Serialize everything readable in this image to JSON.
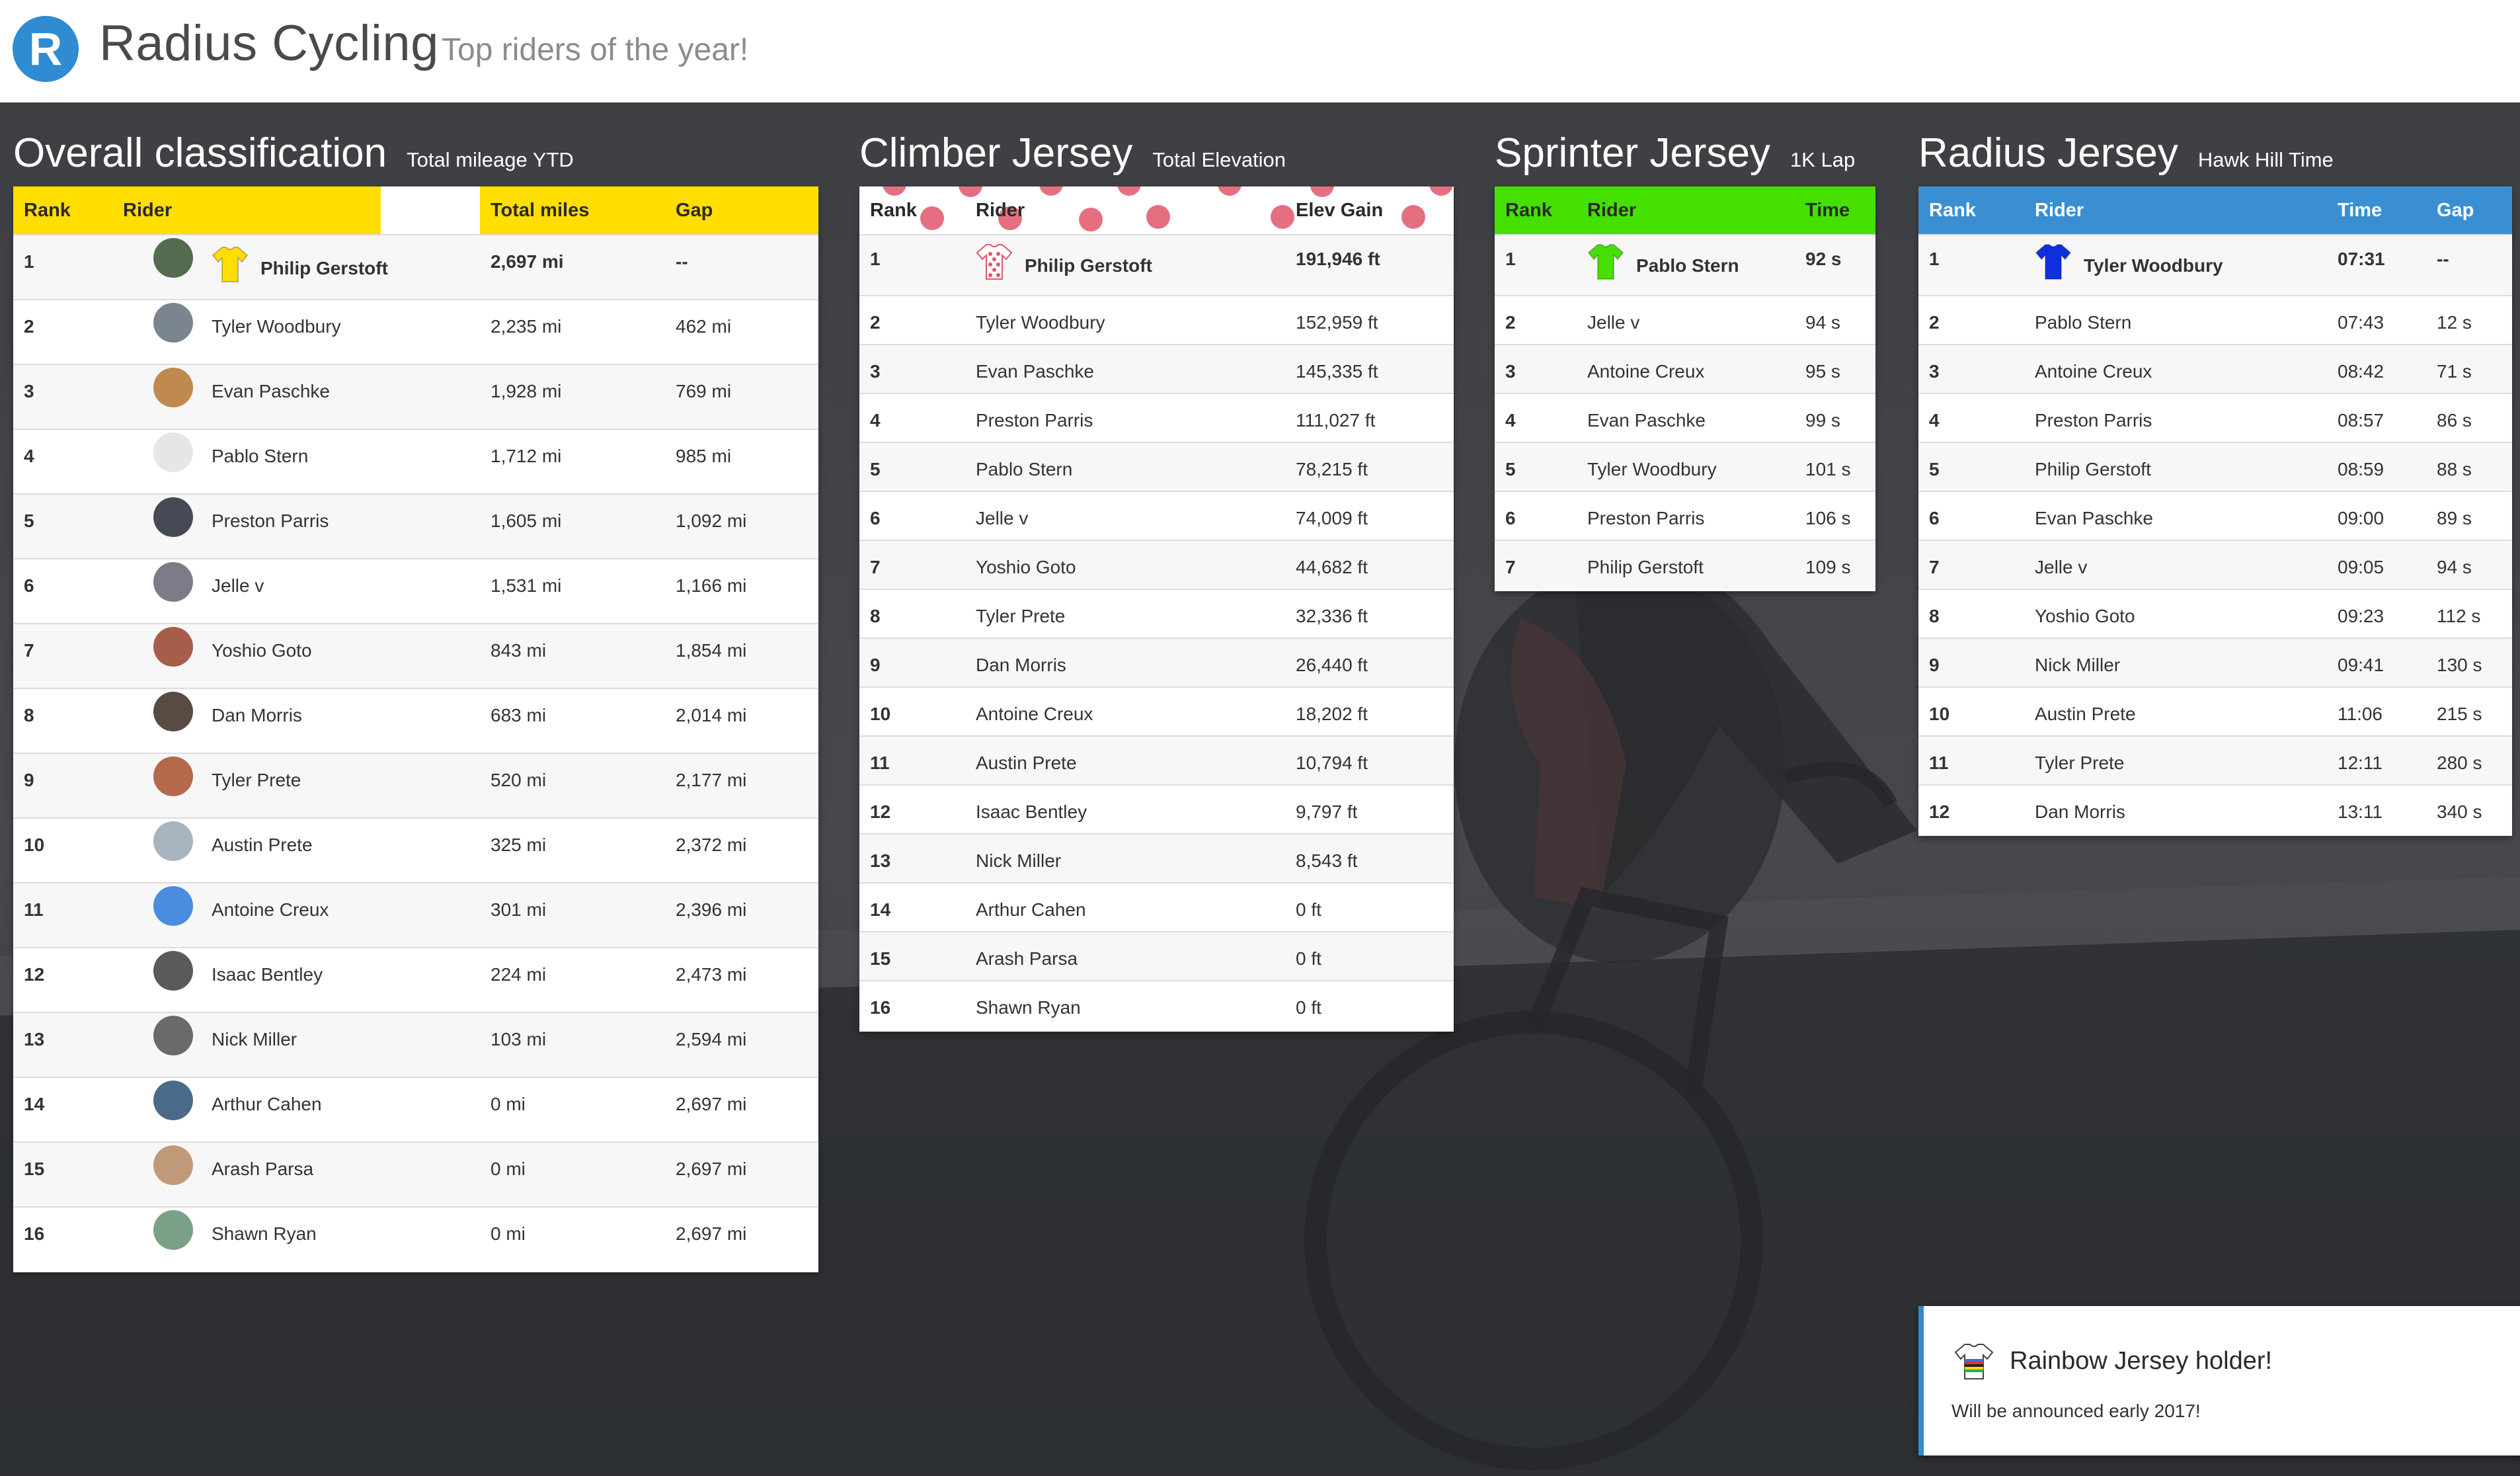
{
  "header": {
    "logo_letter": "R",
    "brand": "Radius Cycling",
    "tagline": "Top riders of the year!"
  },
  "colors": {
    "yellow": "#ffde00",
    "green": "#46e000",
    "blue": "#3a8fd3",
    "polka": "#e0566a",
    "brand_blue": "#2f8bd2"
  },
  "overall": {
    "title": "Overall classification",
    "subtitle": "Total mileage YTD",
    "columns": [
      "Rank",
      "Rider",
      "Total miles",
      "Gap"
    ],
    "rows": [
      [
        "1",
        "Philip Gerstoft",
        "2,697 mi",
        "--"
      ],
      [
        "2",
        "Tyler Woodbury",
        "2,235 mi",
        "462 mi"
      ],
      [
        "3",
        "Evan Paschke",
        "1,928 mi",
        "769 mi"
      ],
      [
        "4",
        "Pablo Stern",
        "1,712 mi",
        "985 mi"
      ],
      [
        "5",
        "Preston Parris",
        "1,605 mi",
        "1,092 mi"
      ],
      [
        "6",
        "Jelle v",
        "1,531 mi",
        "1,166 mi"
      ],
      [
        "7",
        "Yoshio Goto",
        "843 mi",
        "1,854 mi"
      ],
      [
        "8",
        "Dan Morris",
        "683 mi",
        "2,014 mi"
      ],
      [
        "9",
        "Tyler Prete",
        "520 mi",
        "2,177 mi"
      ],
      [
        "10",
        "Austin Prete",
        "325 mi",
        "2,372 mi"
      ],
      [
        "11",
        "Antoine Creux",
        "301 mi",
        "2,396 mi"
      ],
      [
        "12",
        "Isaac Bentley",
        "224 mi",
        "2,473 mi"
      ],
      [
        "13",
        "Nick Miller",
        "103 mi",
        "2,594 mi"
      ],
      [
        "14",
        "Arthur Cahen",
        "0 mi",
        "2,697 mi"
      ],
      [
        "15",
        "Arash Parsa",
        "0 mi",
        "2,697 mi"
      ],
      [
        "16",
        "Shawn Ryan",
        "0 mi",
        "2,697 mi"
      ]
    ]
  },
  "climber": {
    "title": "Climber Jersey",
    "subtitle": "Total Elevation",
    "columns": [
      "Rank",
      "Rider",
      "Elev Gain"
    ],
    "rows": [
      [
        "1",
        "Philip Gerstoft",
        "191,946 ft"
      ],
      [
        "2",
        "Tyler Woodbury",
        "152,959 ft"
      ],
      [
        "3",
        "Evan Paschke",
        "145,335 ft"
      ],
      [
        "4",
        "Preston Parris",
        "111,027 ft"
      ],
      [
        "5",
        "Pablo Stern",
        "78,215 ft"
      ],
      [
        "6",
        "Jelle v",
        "74,009 ft"
      ],
      [
        "7",
        "Yoshio Goto",
        "44,682 ft"
      ],
      [
        "8",
        "Tyler Prete",
        "32,336 ft"
      ],
      [
        "9",
        "Dan Morris",
        "26,440 ft"
      ],
      [
        "10",
        "Antoine Creux",
        "18,202 ft"
      ],
      [
        "11",
        "Austin Prete",
        "10,794 ft"
      ],
      [
        "12",
        "Isaac Bentley",
        "9,797 ft"
      ],
      [
        "13",
        "Nick Miller",
        "8,543 ft"
      ],
      [
        "14",
        "Arthur Cahen",
        "0 ft"
      ],
      [
        "15",
        "Arash Parsa",
        "0 ft"
      ],
      [
        "16",
        "Shawn Ryan",
        "0 ft"
      ]
    ]
  },
  "sprinter": {
    "title": "Sprinter Jersey",
    "subtitle": "1K Lap",
    "columns": [
      "Rank",
      "Rider",
      "Time"
    ],
    "rows": [
      [
        "1",
        "Pablo Stern",
        "92 s"
      ],
      [
        "2",
        "Jelle v",
        "94 s"
      ],
      [
        "3",
        "Antoine Creux",
        "95 s"
      ],
      [
        "4",
        "Evan Paschke",
        "99 s"
      ],
      [
        "5",
        "Tyler Woodbury",
        "101 s"
      ],
      [
        "6",
        "Preston Parris",
        "106 s"
      ],
      [
        "7",
        "Philip Gerstoft",
        "109 s"
      ]
    ]
  },
  "radius": {
    "title": "Radius Jersey",
    "subtitle": "Hawk Hill Time",
    "columns": [
      "Rank",
      "Rider",
      "Time",
      "Gap"
    ],
    "rows": [
      [
        "1",
        "Tyler Woodbury",
        "07:31",
        "--"
      ],
      [
        "2",
        "Pablo Stern",
        "07:43",
        "12 s"
      ],
      [
        "3",
        "Antoine Creux",
        "08:42",
        "71 s"
      ],
      [
        "4",
        "Preston Parris",
        "08:57",
        "86 s"
      ],
      [
        "5",
        "Philip Gerstoft",
        "08:59",
        "88 s"
      ],
      [
        "6",
        "Evan Paschke",
        "09:00",
        "89 s"
      ],
      [
        "7",
        "Jelle v",
        "09:05",
        "94 s"
      ],
      [
        "8",
        "Yoshio Goto",
        "09:23",
        "112 s"
      ],
      [
        "9",
        "Nick Miller",
        "09:41",
        "130 s"
      ],
      [
        "10",
        "Austin Prete",
        "11:06",
        "215 s"
      ],
      [
        "11",
        "Tyler Prete",
        "12:11",
        "280 s"
      ],
      [
        "12",
        "Dan Morris",
        "13:11",
        "340 s"
      ]
    ]
  },
  "toast": {
    "title": "Rainbow Jersey holder!",
    "body": "Will be announced early 2017!"
  }
}
